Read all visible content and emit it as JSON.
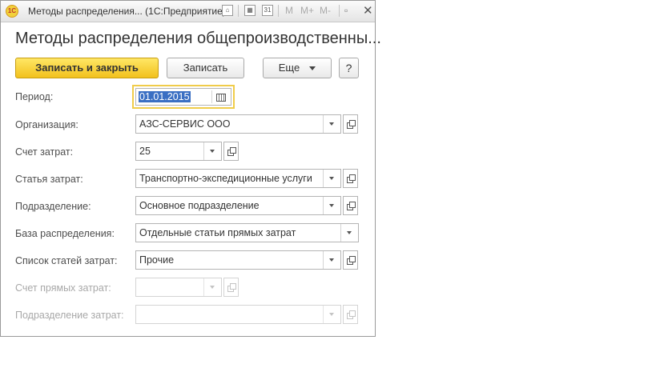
{
  "window": {
    "title": "Методы распределения... (1С:Предприятие)",
    "logo": "1С",
    "toolbar_icons": [
      "link-icon",
      "table-icon",
      "calendar-icon"
    ],
    "memory_buttons": [
      "M",
      "M+",
      "M-"
    ],
    "close_label": "✕"
  },
  "form": {
    "title": "Методы распределения общепроизводственны...",
    "buttons": {
      "save_close": "Записать и закрыть",
      "save": "Записать",
      "more": "Еще",
      "help": "?"
    },
    "fields": {
      "period": {
        "label": "Период:",
        "value": "01.01.2015"
      },
      "organization": {
        "label": "Организация:",
        "value": "АЗС-СЕРВИС ООО"
      },
      "cost_account": {
        "label": "Счет затрат:",
        "value": "25"
      },
      "cost_item": {
        "label": "Статья затрат:",
        "value": "Транспортно-экспедиционные услуги"
      },
      "department": {
        "label": "Подразделение:",
        "value": "Основное подразделение"
      },
      "distribution_base": {
        "label": "База распределения:",
        "value": "Отдельные статьи прямых затрат"
      },
      "cost_items_list": {
        "label": "Список статей затрат:",
        "value": "Прочие"
      },
      "direct_cost_account": {
        "label": "Счет прямых затрат:",
        "value": ""
      },
      "cost_department": {
        "label": "Подразделение затрат:",
        "value": ""
      }
    }
  }
}
